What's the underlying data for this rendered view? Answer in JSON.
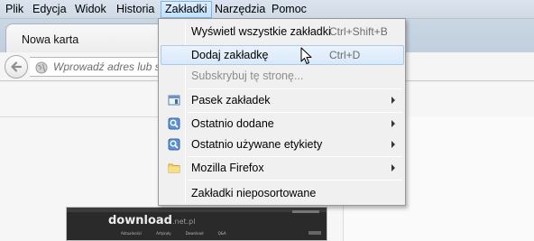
{
  "menubar": {
    "items": [
      {
        "label": "Plik"
      },
      {
        "label": "Edycja"
      },
      {
        "label": "Widok"
      },
      {
        "label": "Historia"
      },
      {
        "label": "Zakładki"
      },
      {
        "label": "Narzędzia"
      },
      {
        "label": "Pomoc"
      }
    ],
    "active_index": 4
  },
  "tabs": [
    {
      "label": "Nowa karta"
    }
  ],
  "navbar": {
    "url_placeholder": "Wprowadź adres lub s"
  },
  "bookmarks_menu": {
    "items": [
      {
        "label": "Wyświetl wszystkie zakładki",
        "shortcut": "Ctrl+Shift+B",
        "icon": "",
        "submenu": false,
        "disabled": false,
        "hover": false
      },
      {
        "label": "Dodaj zakładkę",
        "shortcut": "Ctrl+D",
        "icon": "",
        "submenu": false,
        "disabled": false,
        "hover": true
      },
      {
        "label": "Subskrybuj tę stronę...",
        "shortcut": "",
        "icon": "",
        "submenu": false,
        "disabled": true,
        "hover": false
      },
      {
        "label": "Pasek zakładek",
        "shortcut": "",
        "icon": "bookmarks-toolbar-icon",
        "submenu": true,
        "disabled": false,
        "hover": false
      },
      {
        "label": "Ostatnio dodane",
        "shortcut": "",
        "icon": "smart-folder-icon",
        "submenu": true,
        "disabled": false,
        "hover": false
      },
      {
        "label": "Ostatnio używane etykiety",
        "shortcut": "",
        "icon": "smart-folder-icon",
        "submenu": true,
        "disabled": false,
        "hover": false
      },
      {
        "label": "Mozilla Firefox",
        "shortcut": "",
        "icon": "folder-icon",
        "submenu": true,
        "disabled": false,
        "hover": false
      },
      {
        "label": "Zakładki nieposortowane",
        "shortcut": "",
        "icon": "",
        "submenu": false,
        "disabled": false,
        "hover": false
      }
    ]
  },
  "thumbnail": {
    "brand": "download",
    "brand_suffix": ".net.pl",
    "nav_items": [
      "Aktualności",
      "Artykuły",
      "Download",
      "Q&A"
    ]
  },
  "colors": {
    "menubar_bg": "#d5dfea",
    "active_menu_border": "#7eb4ea",
    "hover_item_bg": "#dcebfc",
    "disabled_text": "#8d8d8d"
  }
}
